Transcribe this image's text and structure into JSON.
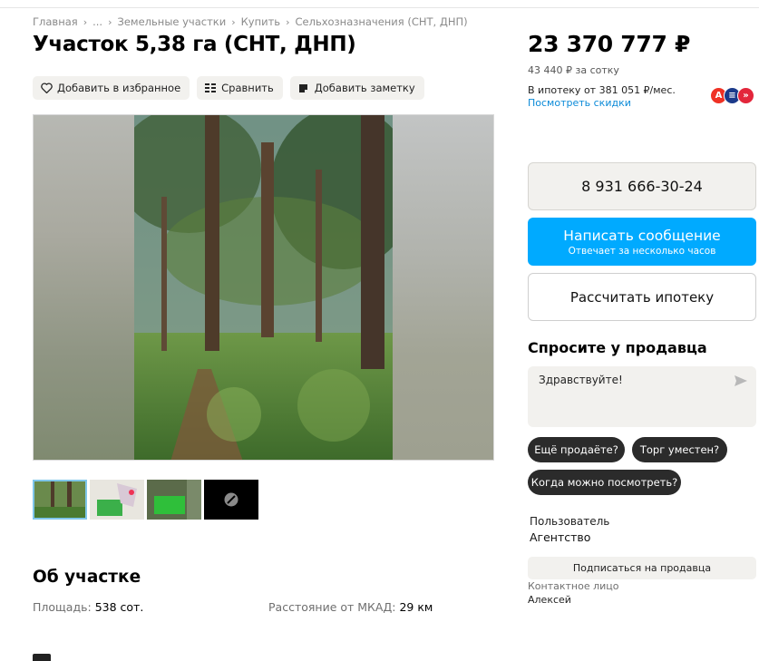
{
  "breadcrumb": [
    "Главная",
    "...",
    "Земельные участки",
    "Купить",
    "Сельхозназначения (СНТ, ДНП)"
  ],
  "title": "Участок 5,38 га (СНТ, ДНП)",
  "actions": {
    "favorite": "Добавить в избранное",
    "compare": "Сравнить",
    "note": "Добавить заметку"
  },
  "price": {
    "amount": "23 370 777 ₽",
    "per_sotka": "43 440 ₽ за сотку",
    "mortgage": "В ипотеку от 381 051 ₽/мес.",
    "discounts": "Посмотреть скидки"
  },
  "banks": [
    {
      "icon": "alfa-bank-icon",
      "color": "#ef3124",
      "glyph": "А"
    },
    {
      "icon": "bank-blue-icon",
      "color": "#1b3a8a",
      "glyph": "≡"
    },
    {
      "icon": "bank-red-icon",
      "color": "#e3263b",
      "glyph": "»"
    }
  ],
  "contacts": {
    "phone": "8 931 666-30-24",
    "message": "Написать сообщение",
    "message_sub": "Отвечает за несколько часов",
    "calc_mortgage": "Рассчитать ипотеку"
  },
  "ask": {
    "title": "Спросите у продавца",
    "message": "Здравствуйте!",
    "chips": [
      "Ещё продаёте?",
      "Торг уместен?",
      "Когда можно посмотреть?"
    ]
  },
  "seller": {
    "type": "Пользователь",
    "name": "Агентство",
    "subscribe": "Подписаться на продавца",
    "contact_label": "Контактное лицо",
    "contact_name": "Алексей"
  },
  "about": {
    "title": "Об участке",
    "params": [
      {
        "label": "Площадь:",
        "value": "538 сот."
      },
      {
        "label": "Расстояние от МКАД:",
        "value": "29 км"
      }
    ]
  },
  "colors": {
    "accent": "#00aaff",
    "link": "#0a8ad8",
    "button_bg": "#f2f1ee",
    "chip_bg": "#2b2b2b"
  }
}
